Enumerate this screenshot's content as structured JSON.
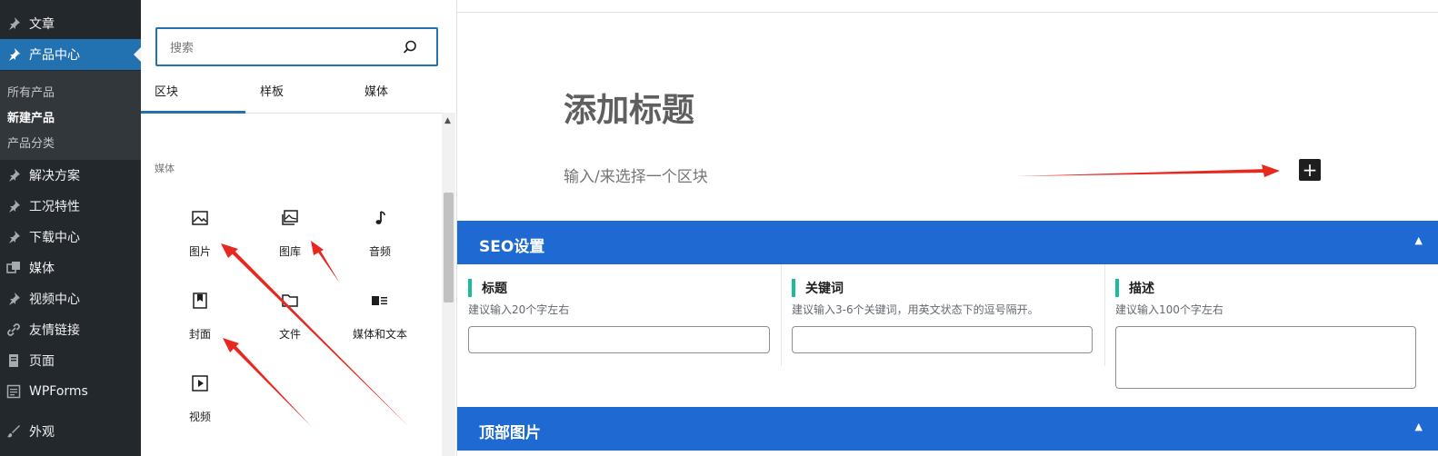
{
  "sidebar": {
    "items": [
      {
        "label": "文章",
        "icon": "pin-icon"
      },
      {
        "label": "产品中心",
        "icon": "pin-icon"
      },
      {
        "label": "解决方案",
        "icon": "pin-icon"
      },
      {
        "label": "工况特性",
        "icon": "pin-icon"
      },
      {
        "label": "下载中心",
        "icon": "pin-icon"
      },
      {
        "label": "媒体",
        "icon": "media-icon"
      },
      {
        "label": "视频中心",
        "icon": "pin-icon"
      },
      {
        "label": "友情链接",
        "icon": "link-icon"
      },
      {
        "label": "页面",
        "icon": "page-icon"
      },
      {
        "label": "WPForms",
        "icon": "forms-icon"
      },
      {
        "label": "外观",
        "icon": "brush-icon"
      }
    ],
    "submenu": [
      "所有产品",
      "新建产品",
      "产品分类"
    ],
    "accent": "#2271b1"
  },
  "inserter": {
    "search_placeholder": "搜索",
    "tabs": [
      "区块",
      "样板",
      "媒体"
    ],
    "section_title": "媒体",
    "blocks": [
      {
        "label": "图片",
        "icon": "image-icon"
      },
      {
        "label": "图库",
        "icon": "gallery-icon"
      },
      {
        "label": "音频",
        "icon": "audio-icon"
      },
      {
        "label": "封面",
        "icon": "cover-icon"
      },
      {
        "label": "文件",
        "icon": "file-icon"
      },
      {
        "label": "媒体和文本",
        "icon": "media-text-icon"
      },
      {
        "label": "视频",
        "icon": "video-icon"
      }
    ]
  },
  "editor": {
    "title_placeholder": "添加标题",
    "block_prompt": "输入/来选择一个区块",
    "add_block_label": "+"
  },
  "seo_box": {
    "title": "SEO设置",
    "header_color": "#1e6ad2",
    "fields": [
      {
        "label": "标题",
        "hint": "建议输入20个字左右",
        "value": ""
      },
      {
        "label": "关键词",
        "hint": "建议输入3-6个关键词，用英文状态下的逗号隔开。",
        "value": ""
      },
      {
        "label": "描述",
        "hint": "建议输入100个字左右",
        "value": ""
      }
    ]
  },
  "top_image_box": {
    "title": "顶部图片"
  },
  "annotation_color": "#e8271f"
}
